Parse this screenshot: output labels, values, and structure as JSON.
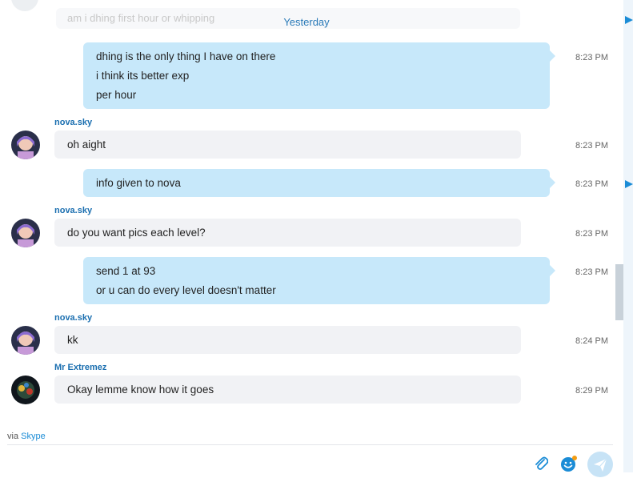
{
  "history": {
    "faded_message": "am i dhing first hour or whipping",
    "date_separator": "Yesterday"
  },
  "messages": [
    {
      "type": "out",
      "lines": [
        "dhing is the only thing I have on there",
        "i think its better exp",
        "per hour"
      ],
      "time": "8:23 PM"
    },
    {
      "type": "in",
      "sender": "nova.sky",
      "lines": [
        "oh aight"
      ],
      "time": "8:23 PM"
    },
    {
      "type": "out",
      "lines": [
        "info given to nova"
      ],
      "time": "8:23 PM"
    },
    {
      "type": "in",
      "sender": "nova.sky",
      "lines": [
        "do you want pics each level?"
      ],
      "time": "8:23 PM"
    },
    {
      "type": "out",
      "lines": [
        "send 1 at 93",
        "or u can do every level doesn't matter"
      ],
      "time": "8:23 PM"
    },
    {
      "type": "in",
      "sender": "nova.sky",
      "lines": [
        "kk"
      ],
      "time": "8:24 PM"
    },
    {
      "type": "in",
      "sender": "Mr Extremez",
      "lines": [
        "Okay lemme know how it goes"
      ],
      "time": "8:29 PM"
    }
  ],
  "footer": {
    "via_prefix": "via",
    "via_link": "Skype"
  },
  "icons": {
    "attach": "paperclip-icon",
    "emoji": "emoticon-icon",
    "send": "send-icon"
  },
  "colors": {
    "outgoing_bubble": "#c7e8fa",
    "incoming_bubble": "#f1f2f5",
    "sender_name": "#1b6fb0",
    "accent": "#1b8cd6"
  }
}
